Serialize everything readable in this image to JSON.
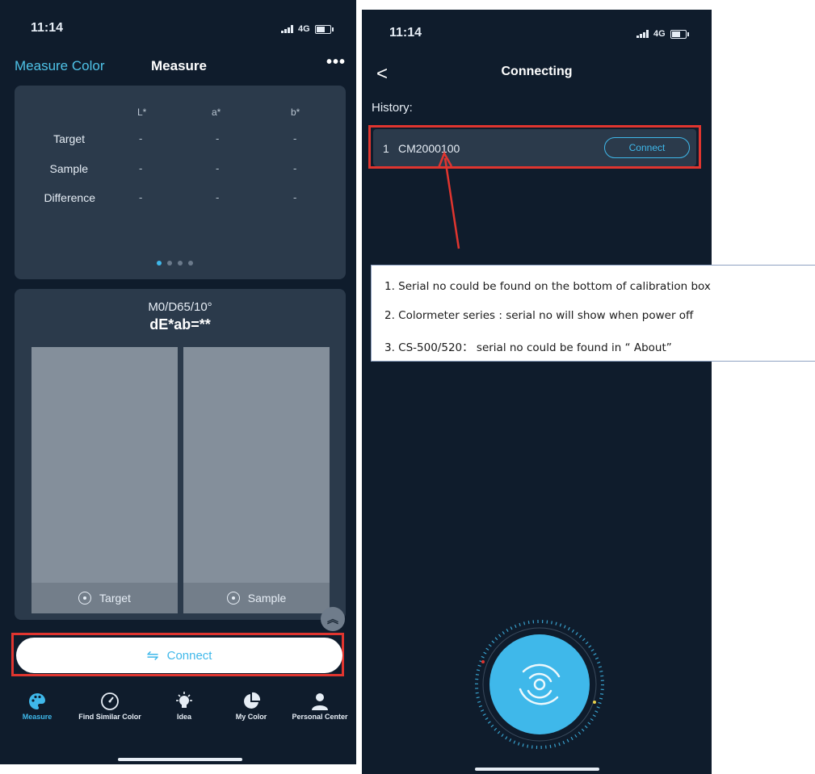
{
  "left": {
    "status": {
      "time": "11:14",
      "network": "4G"
    },
    "header": {
      "back_label": "Measure Color",
      "title": "Measure",
      "more": "•••"
    },
    "lab_table": {
      "columns": [
        "L*",
        "a*",
        "b*"
      ],
      "rows": [
        {
          "label": "Target",
          "values": [
            "-",
            "-",
            "-"
          ]
        },
        {
          "label": "Sample",
          "values": [
            "-",
            "-",
            "-"
          ]
        },
        {
          "label": "Difference",
          "values": [
            "-",
            "-",
            "-"
          ]
        }
      ]
    },
    "compare": {
      "standard": "M0/D65/10°",
      "delta": "dE*ab=**",
      "target_label": "Target",
      "sample_label": "Sample"
    },
    "connect_label": "Connect",
    "nav": [
      {
        "label": "Measure",
        "icon": "palette-icon",
        "active": true
      },
      {
        "label": "Find Similar Color",
        "icon": "speedometer-icon",
        "active": false
      },
      {
        "label": "Idea",
        "icon": "lightbulb-icon",
        "active": false
      },
      {
        "label": "My Color",
        "icon": "pie-chart-icon",
        "active": false
      },
      {
        "label": "Personal Center",
        "icon": "person-icon",
        "active": false
      }
    ]
  },
  "right": {
    "status": {
      "time": "11:14",
      "network": "4G"
    },
    "header": {
      "back": "<",
      "title": "Connecting"
    },
    "history_label": "History:",
    "device": {
      "index": "1",
      "name": "CM2000100",
      "connect_label": "Connect"
    }
  },
  "notes": [
    "1.  Serial no could be found on the bottom of calibration box",
    "2.  Colormeter series : serial no will show when power off",
    "3.  CS-500/520：     serial no could be found in “ About”"
  ],
  "colors": {
    "background": "#0f1c2c",
    "card": "#2b3a4b",
    "accent": "#3fb8ea",
    "highlight": "#e0352f"
  }
}
